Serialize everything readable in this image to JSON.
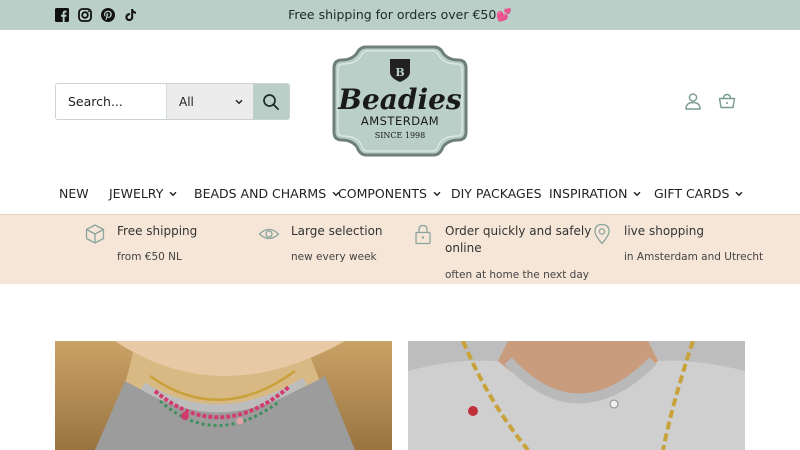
{
  "announcement": {
    "text": "Free shipping for orders over €50💕",
    "socials": [
      "facebook-icon",
      "instagram-icon",
      "pinterest-icon",
      "tiktok-icon"
    ]
  },
  "header": {
    "search": {
      "placeholder": "Search...",
      "category": "All"
    },
    "logo": {
      "badge": "B",
      "name": "Beadies",
      "city": "AMSTERDAM",
      "since": "SINCE 1998"
    },
    "icons": [
      "account-icon",
      "cart-icon"
    ]
  },
  "nav": {
    "items": [
      {
        "label": "NEW",
        "dropdown": false
      },
      {
        "label": "JEWELRY",
        "dropdown": true
      },
      {
        "label": "BEADS AND CHARMS",
        "dropdown": true
      },
      {
        "label": "COMPONENTS",
        "dropdown": true
      },
      {
        "label": "DIY PACKAGES",
        "dropdown": false
      },
      {
        "label": "INSPIRATION",
        "dropdown": true
      },
      {
        "label": "GIFT CARDS",
        "dropdown": true
      }
    ]
  },
  "usp": [
    {
      "icon": "box-icon",
      "title": "Free shipping",
      "sub": "from €50 NL"
    },
    {
      "icon": "eye-icon",
      "title": "Large selection",
      "sub": "new every week"
    },
    {
      "icon": "lock-icon",
      "title": "Order quickly and safely online",
      "title_line1": "Order quickly and safely",
      "title_line2": "online",
      "sub": "often at home the next day"
    },
    {
      "icon": "location-pin-icon",
      "title": "live shopping",
      "sub": "in Amsterdam and Utrecht"
    }
  ],
  "colors": {
    "topbar": "#b9cfc8",
    "usp_bg": "#f6e6d8",
    "logo_fill": "#b9cfc8",
    "text": "#222222"
  }
}
